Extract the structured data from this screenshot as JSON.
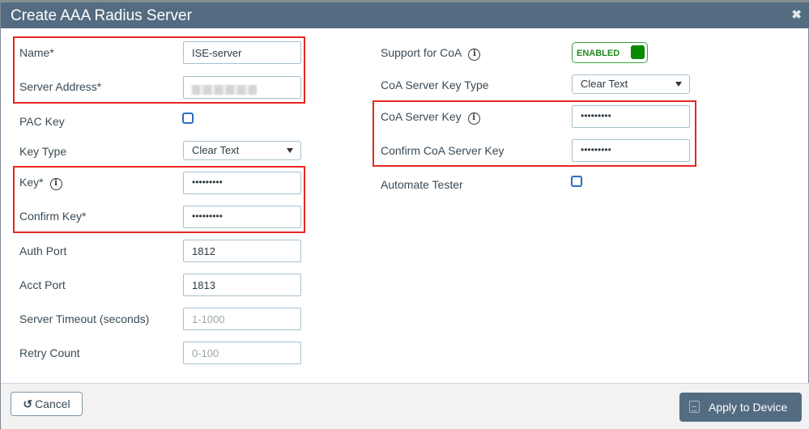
{
  "dialog": {
    "title": "Create AAA Radius Server",
    "close_icon": "close-icon"
  },
  "left": {
    "name": {
      "label": "Name*",
      "value": "ISE-server"
    },
    "server_address": {
      "label": "Server Address*",
      "value": "(blurred)"
    },
    "pac_key": {
      "label": "PAC Key",
      "checked": false
    },
    "key_type": {
      "label": "Key Type",
      "value": "Clear Text"
    },
    "key": {
      "label": "Key*",
      "value": "•••••••••"
    },
    "confirm_key": {
      "label": "Confirm Key*",
      "value": "•••••••••"
    },
    "auth_port": {
      "label": "Auth Port",
      "value": "1812"
    },
    "acct_port": {
      "label": "Acct Port",
      "value": "1813"
    },
    "server_timeout": {
      "label": "Server Timeout (seconds)",
      "placeholder": "1-1000"
    },
    "retry_count": {
      "label": "Retry Count",
      "placeholder": "0-100"
    }
  },
  "right": {
    "support_coa": {
      "label": "Support for CoA",
      "state": "ENABLED"
    },
    "coa_key_type": {
      "label": "CoA Server Key Type",
      "value": "Clear Text"
    },
    "coa_key": {
      "label": "CoA Server Key",
      "value": "•••••••••"
    },
    "confirm_coa_key": {
      "label": "Confirm CoA Server Key",
      "value": "•••••••••"
    },
    "automate_tester": {
      "label": "Automate Tester",
      "checked": false
    }
  },
  "footer": {
    "cancel_label": "Cancel",
    "apply_label": "Apply to Device"
  },
  "info_glyph": "i",
  "cancel_glyph": "↺",
  "colors": {
    "header": "#536c81",
    "highlight": "#e8271f",
    "enabled": "#098a00",
    "checkbox": "#2b6cc4"
  }
}
